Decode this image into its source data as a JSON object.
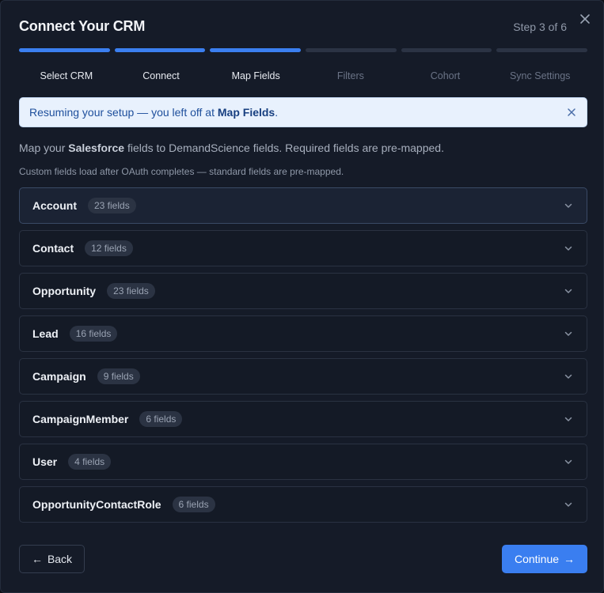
{
  "modal": {
    "title": "Connect Your CRM",
    "step_counter": "Step 3 of 6",
    "close_icon": "close-icon",
    "accent_color": "#3b7ff0"
  },
  "progress": {
    "completed_steps": 3,
    "total_steps": 6,
    "steps": [
      {
        "label": "Select CRM",
        "done": true
      },
      {
        "label": "Connect",
        "done": true
      },
      {
        "label": "Map Fields",
        "done": true
      },
      {
        "label": "Filters",
        "done": false
      },
      {
        "label": "Cohort",
        "done": false
      },
      {
        "label": "Sync Settings",
        "done": false
      }
    ]
  },
  "banner": {
    "text_prefix": "Resuming your setup — you left off at ",
    "text_bold": "Map Fields",
    "text_suffix": ".",
    "close_icon": "close-icon"
  },
  "description": {
    "prefix": "Map your ",
    "crm_name": "Salesforce",
    "suffix": " fields to DemandScience fields. Required fields are pre-mapped."
  },
  "note": "Custom fields load after OAuth completes — standard fields are pre-mapped.",
  "field_groups": [
    {
      "name": "Account",
      "count": "23 fields",
      "active": true
    },
    {
      "name": "Contact",
      "count": "12 fields",
      "active": false
    },
    {
      "name": "Opportunity",
      "count": "23 fields",
      "active": false
    },
    {
      "name": "Lead",
      "count": "16 fields",
      "active": false
    },
    {
      "name": "Campaign",
      "count": "9 fields",
      "active": false
    },
    {
      "name": "CampaignMember",
      "count": "6 fields",
      "active": false
    },
    {
      "name": "User",
      "count": "4 fields",
      "active": false
    },
    {
      "name": "OpportunityContactRole",
      "count": "6 fields",
      "active": false
    }
  ],
  "footer": {
    "back_label": "Back",
    "back_icon": "arrow-left-icon",
    "continue_label": "Continue",
    "continue_icon": "arrow-right-icon"
  }
}
